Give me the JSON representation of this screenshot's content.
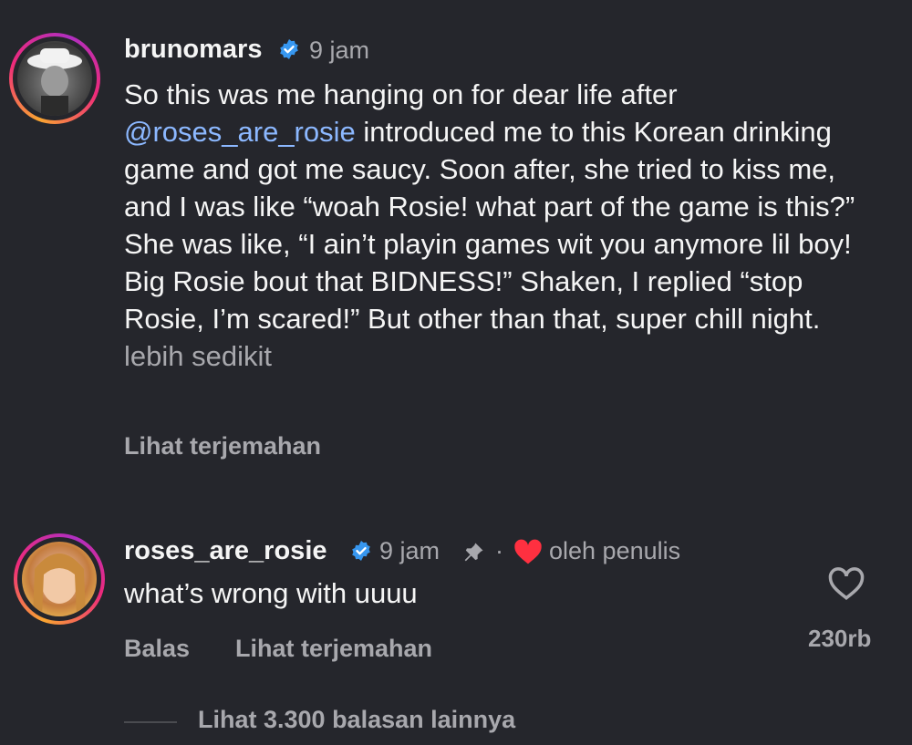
{
  "post": {
    "username": "brunomars",
    "time": "9 jam",
    "caption_before_mention": "So this was me hanging on for dear life after ",
    "mention": "@roses_are_rosie",
    "caption_after_mention": " introduced me to this Korean drinking game and got me saucy. Soon after, she tried to kiss me, and I was like “woah Rosie! what part of the game is this?” She was like, “I ain’t playin games wit you anymore lil boy! Big Rosie bout that BIDNESS!” Shaken, I replied “stop Rosie, I’m scared!” But other than that, super chill night.",
    "less_label": "lebih sedikit",
    "translate_label": "Lihat terjemahan"
  },
  "comment": {
    "username": "roses_are_rosie",
    "time": "9 jam",
    "separator": "·",
    "by_author": "oleh penulis",
    "text": "what’s wrong with uuuu",
    "reply_label": "Balas",
    "translate_label": "Lihat terjemahan",
    "like_count": "230rb",
    "more_replies_label": "Lihat 3.300 balasan lainnya"
  },
  "colors": {
    "background": "#25262c",
    "mention": "#8cb8ff",
    "verified": "#3797f0",
    "heart": "#ff3040",
    "muted": "#a8a8ad"
  }
}
